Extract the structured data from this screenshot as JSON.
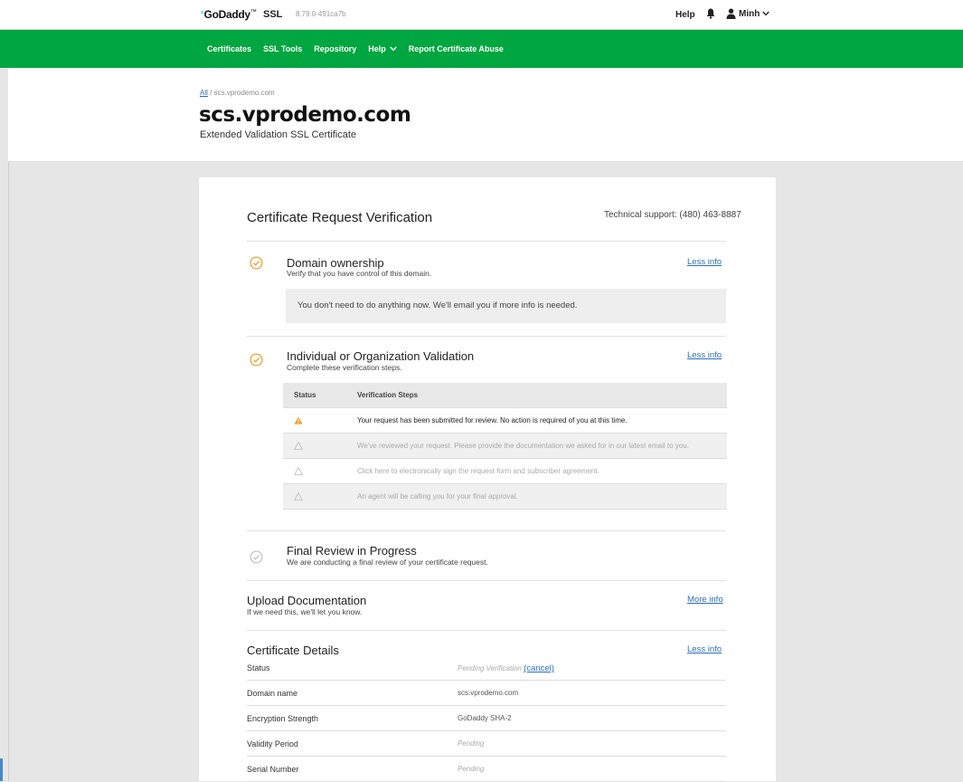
{
  "topbar": {
    "logo": "GoDaddy",
    "logo_tm": "™",
    "product": "SSL",
    "version": "8.79.0-491ca7b",
    "help": "Help",
    "user": "Minh"
  },
  "nav": {
    "items": [
      {
        "label": "Certificates"
      },
      {
        "label": "SSL Tools"
      },
      {
        "label": "Repository"
      },
      {
        "label": "Help"
      },
      {
        "label": "Report Certificate Abuse"
      }
    ]
  },
  "header": {
    "breadcrumb_all": "All",
    "breadcrumb_sep": " / ",
    "breadcrumb_current": "scs.vprodemo.com",
    "title": "scs.vprodemo.com",
    "subtitle": "Extended Validation SSL Certificate"
  },
  "card": {
    "title": "Certificate Request Verification",
    "support": "Technical support: (480) 463-8887",
    "domain": {
      "title": "Domain ownership",
      "subtitle": "Verify that you have control of this domain.",
      "link": "Less info",
      "notice": "You don't need to do anything now. We'll email you if more info is needed."
    },
    "validation": {
      "title": "Individual or Organization Validation",
      "subtitle": "Complete these verification steps.",
      "link": "Less info",
      "col_status": "Status",
      "col_steps": "Verification Steps",
      "steps": [
        {
          "text": "Your request has been submitted for review. No action is required of you at this time."
        },
        {
          "text": "We've reviewed your request. Please provide the documentation we asked for in our latest email to you."
        },
        {
          "text": "Click here to electronically sign the request form and subscriber agreement."
        },
        {
          "text": "An agent will be calling you for your final approval."
        }
      ]
    },
    "final_review": {
      "title": "Final Review in Progress",
      "subtitle": "We are conducting a final review of your certificate request."
    },
    "upload": {
      "title": "Upload Documentation",
      "subtitle": "If we need this, we'll let you know.",
      "link": "More info"
    },
    "details": {
      "title": "Certificate Details",
      "link": "Less info",
      "rows": [
        {
          "key": "Status",
          "value": "Pending Verification",
          "extra": "(cancel)"
        },
        {
          "key": "Domain name",
          "value": "scs.vprodemo.com"
        },
        {
          "key": "Encryption Strength",
          "value": "GoDaddy SHA-2"
        },
        {
          "key": "Validity Period",
          "value": "Pending"
        },
        {
          "key": "Serial Number",
          "value": "Pending"
        }
      ]
    }
  },
  "colors": {
    "brand_green": "#00a63f",
    "warning_orange": "#f0a030",
    "link_blue": "#2a6ebb"
  },
  "icons": {
    "bell": "bell-icon",
    "user": "user-icon",
    "chevron": "chevron-down-icon",
    "check": "check-circle-icon",
    "warning": "warning-triangle-icon"
  }
}
